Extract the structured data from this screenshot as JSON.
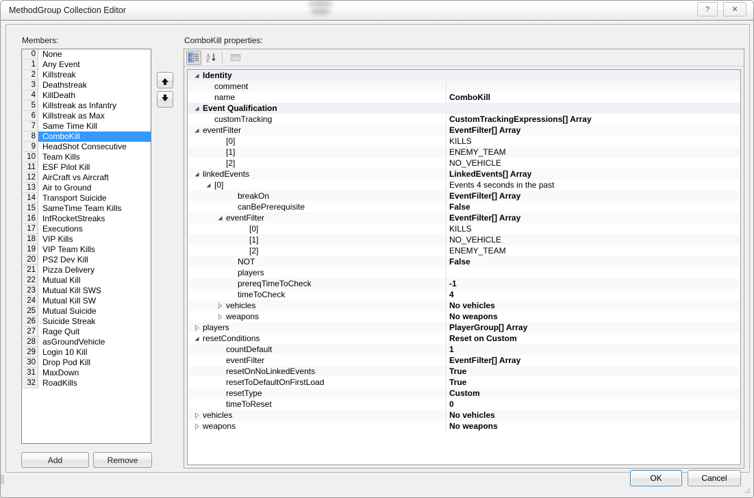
{
  "window": {
    "title": "MethodGroup Collection Editor",
    "help_label": "?",
    "close_label": "✕"
  },
  "members": {
    "label": "Members:",
    "selected_index": 8,
    "items": [
      {
        "index": "0",
        "name": "None"
      },
      {
        "index": "1",
        "name": "Any Event"
      },
      {
        "index": "2",
        "name": "Killstreak"
      },
      {
        "index": "3",
        "name": "Deathstreak"
      },
      {
        "index": "4",
        "name": "KillDeath"
      },
      {
        "index": "5",
        "name": "Killstreak as Infantry"
      },
      {
        "index": "6",
        "name": "Killstreak as Max"
      },
      {
        "index": "7",
        "name": "Same Time Kill"
      },
      {
        "index": "8",
        "name": "ComboKill"
      },
      {
        "index": "9",
        "name": "HeadShot Consecutive"
      },
      {
        "index": "10",
        "name": "Team Kills"
      },
      {
        "index": "11",
        "name": "ESF Pilot Kill"
      },
      {
        "index": "12",
        "name": "AirCraft vs Aircraft"
      },
      {
        "index": "13",
        "name": "Air to Ground"
      },
      {
        "index": "14",
        "name": "Transport Suicide"
      },
      {
        "index": "15",
        "name": "SameTime Team Kills"
      },
      {
        "index": "16",
        "name": "InfRocketStreaks"
      },
      {
        "index": "17",
        "name": "Executions"
      },
      {
        "index": "18",
        "name": "VIP Kills"
      },
      {
        "index": "19",
        "name": "VIP Team Kills"
      },
      {
        "index": "20",
        "name": "PS2 Dev Kill"
      },
      {
        "index": "21",
        "name": "Pizza Delivery"
      },
      {
        "index": "22",
        "name": "Mutual Kill"
      },
      {
        "index": "23",
        "name": "Mutual Kill SWS"
      },
      {
        "index": "24",
        "name": "Mutual Kill SW"
      },
      {
        "index": "25",
        "name": "Mutual Suicide"
      },
      {
        "index": "26",
        "name": "Suicide Streak"
      },
      {
        "index": "27",
        "name": "Rage Quit"
      },
      {
        "index": "28",
        "name": "asGroundVehicle"
      },
      {
        "index": "29",
        "name": "Login 10 Kill"
      },
      {
        "index": "30",
        "name": "Drop Pod Kill"
      },
      {
        "index": "31",
        "name": "MaxDown"
      },
      {
        "index": "32",
        "name": "RoadKills"
      }
    ],
    "move_up_label": "▲",
    "move_down_label": "▼",
    "add_label": "Add",
    "remove_label": "Remove"
  },
  "properties": {
    "label": "ComboKill properties:",
    "toolbar": {
      "categorized_tooltip": "Categorized",
      "alphabetical_label": "A\nZ",
      "property_pages_tooltip": "Property Pages"
    },
    "rows": [
      {
        "kind": "category",
        "indent": 0,
        "expander": "expanded",
        "name": "Identity",
        "value": "",
        "bold": false
      },
      {
        "kind": "prop",
        "indent": 1,
        "expander": "none",
        "name": "comment",
        "value": "",
        "bold": false
      },
      {
        "kind": "prop",
        "indent": 1,
        "expander": "none",
        "name": "name",
        "value": "ComboKill",
        "bold": true
      },
      {
        "kind": "category",
        "indent": 0,
        "expander": "expanded",
        "name": "Event Qualification",
        "value": "",
        "bold": false
      },
      {
        "kind": "prop",
        "indent": 1,
        "expander": "none",
        "name": "customTracking",
        "value": "CustomTrackingExpressions[] Array",
        "bold": true
      },
      {
        "kind": "prop",
        "indent": 0,
        "expander": "expanded",
        "name": "eventFilter",
        "value": "EventFilter[] Array",
        "bold": true
      },
      {
        "kind": "prop",
        "indent": 2,
        "expander": "none",
        "name": "[0]",
        "value": "KILLS",
        "bold": false
      },
      {
        "kind": "prop",
        "indent": 2,
        "expander": "none",
        "name": "[1]",
        "value": "ENEMY_TEAM",
        "bold": false
      },
      {
        "kind": "prop",
        "indent": 2,
        "expander": "none",
        "name": "[2]",
        "value": "NO_VEHICLE",
        "bold": false
      },
      {
        "kind": "prop",
        "indent": 0,
        "expander": "expanded",
        "name": "linkedEvents",
        "value": "LinkedEvents[] Array",
        "bold": true
      },
      {
        "kind": "prop",
        "indent": 1,
        "expander": "expanded",
        "name": "[0]",
        "value": "Events 4 seconds in the past",
        "bold": false
      },
      {
        "kind": "prop",
        "indent": 3,
        "expander": "none",
        "name": "breakOn",
        "value": "EventFilter[] Array",
        "bold": true
      },
      {
        "kind": "prop",
        "indent": 3,
        "expander": "none",
        "name": "canBePrerequisite",
        "value": "False",
        "bold": true
      },
      {
        "kind": "prop",
        "indent": 2,
        "expander": "expanded",
        "name": "eventFilter",
        "value": "EventFilter[] Array",
        "bold": true
      },
      {
        "kind": "prop",
        "indent": 4,
        "expander": "none",
        "name": "[0]",
        "value": "KILLS",
        "bold": false
      },
      {
        "kind": "prop",
        "indent": 4,
        "expander": "none",
        "name": "[1]",
        "value": "NO_VEHICLE",
        "bold": false
      },
      {
        "kind": "prop",
        "indent": 4,
        "expander": "none",
        "name": "[2]",
        "value": "ENEMY_TEAM",
        "bold": false
      },
      {
        "kind": "prop",
        "indent": 3,
        "expander": "none",
        "name": "NOT",
        "value": "False",
        "bold": true
      },
      {
        "kind": "prop",
        "indent": 3,
        "expander": "none",
        "name": "players",
        "value": "",
        "bold": false
      },
      {
        "kind": "prop",
        "indent": 3,
        "expander": "none",
        "name": "prereqTimeToCheck",
        "value": "-1",
        "bold": true
      },
      {
        "kind": "prop",
        "indent": 3,
        "expander": "none",
        "name": "timeToCheck",
        "value": "4",
        "bold": true
      },
      {
        "kind": "prop",
        "indent": 2,
        "expander": "collapsed",
        "name": "vehicles",
        "value": "No vehicles",
        "bold": true
      },
      {
        "kind": "prop",
        "indent": 2,
        "expander": "collapsed",
        "name": "weapons",
        "value": "No weapons",
        "bold": true
      },
      {
        "kind": "prop",
        "indent": 0,
        "expander": "collapsed",
        "name": "players",
        "value": "PlayerGroup[] Array",
        "bold": true
      },
      {
        "kind": "prop",
        "indent": 0,
        "expander": "expanded",
        "name": "resetConditions",
        "value": "Reset on Custom",
        "bold": true
      },
      {
        "kind": "prop",
        "indent": 2,
        "expander": "none",
        "name": "countDefault",
        "value": "1",
        "bold": true
      },
      {
        "kind": "prop",
        "indent": 2,
        "expander": "none",
        "name": "eventFilter",
        "value": "EventFilter[] Array",
        "bold": true
      },
      {
        "kind": "prop",
        "indent": 2,
        "expander": "none",
        "name": "resetOnNoLinkedEvents",
        "value": "True",
        "bold": true
      },
      {
        "kind": "prop",
        "indent": 2,
        "expander": "none",
        "name": "resetToDefaultOnFirstLoad",
        "value": "True",
        "bold": true
      },
      {
        "kind": "prop",
        "indent": 2,
        "expander": "none",
        "name": "resetType",
        "value": "Custom",
        "bold": true
      },
      {
        "kind": "prop",
        "indent": 2,
        "expander": "none",
        "name": "timeToReset",
        "value": "0",
        "bold": true
      },
      {
        "kind": "prop",
        "indent": 0,
        "expander": "collapsed",
        "name": "vehicles",
        "value": "No vehicles",
        "bold": true
      },
      {
        "kind": "prop",
        "indent": 0,
        "expander": "collapsed",
        "name": "weapons",
        "value": "No weapons",
        "bold": true
      }
    ]
  },
  "footer": {
    "ok_label": "OK",
    "cancel_label": "Cancel"
  },
  "colors": {
    "selection": "#3399ff",
    "category_row": "#eef2f7",
    "alt_row": "#f7f9fb",
    "focus_border": "#3c7fb1"
  }
}
